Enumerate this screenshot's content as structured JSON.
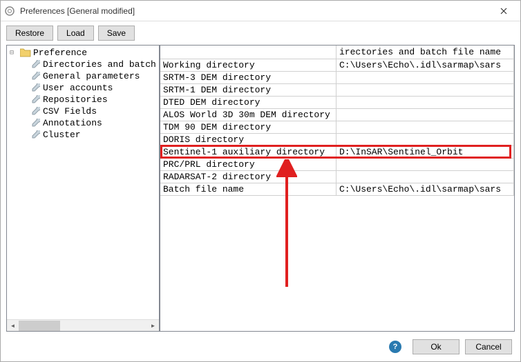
{
  "window": {
    "title": "Preferences [General modified]"
  },
  "toolbar": {
    "restore": "Restore",
    "load": "Load",
    "save": "Save"
  },
  "tree": {
    "root": "Preference",
    "items": [
      "Directories and batch",
      "General parameters",
      "User accounts",
      "Repositories",
      "CSV Fields",
      "Annotations",
      "Cluster"
    ]
  },
  "table": {
    "header_col1": "",
    "header_col2": "irectories and batch file name",
    "rows": [
      {
        "label": "Working directory",
        "value": "C:\\Users\\Echo\\.idl\\sarmap\\sars"
      },
      {
        "label": "SRTM-3 DEM directory",
        "value": ""
      },
      {
        "label": "SRTM-1 DEM directory",
        "value": ""
      },
      {
        "label": "DTED DEM directory",
        "value": ""
      },
      {
        "label": "ALOS World 3D 30m DEM directory",
        "value": ""
      },
      {
        "label": "TDM 90 DEM directory",
        "value": ""
      },
      {
        "label": "DORIS directory",
        "value": ""
      },
      {
        "label": "Sentinel-1 auxiliary directory",
        "value": "D:\\InSAR\\Sentinel_Orbit"
      },
      {
        "label": "PRC/PRL directory",
        "value": ""
      },
      {
        "label": "RADARSAT-2 directory",
        "value": ""
      },
      {
        "label": "Batch file name",
        "value": "C:\\Users\\Echo\\.idl\\sarmap\\sars"
      }
    ],
    "highlight_row_index": 7
  },
  "footer": {
    "ok": "Ok",
    "cancel": "Cancel"
  }
}
